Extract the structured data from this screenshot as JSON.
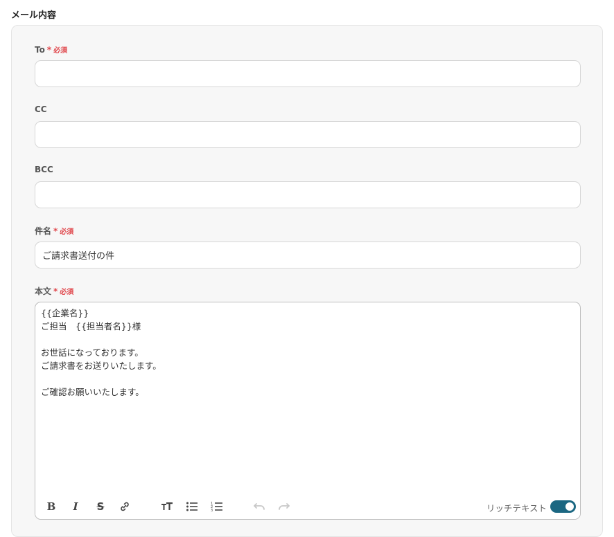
{
  "section": {
    "title": "メール内容"
  },
  "required_text": "必須",
  "required_star": "*",
  "fields": {
    "to": {
      "label": "To",
      "value": ""
    },
    "cc": {
      "label": "CC",
      "value": ""
    },
    "bcc": {
      "label": "BCC",
      "value": ""
    },
    "subject": {
      "label": "件名",
      "value": "ご請求書送付の件"
    },
    "body": {
      "label": "本文",
      "value": "{{企業名}}\nご担当　{{担当者名}}様\n\nお世話になっております。\nご請求書をお送りいたします。\n\nご確認お願いいたします。"
    }
  },
  "toolbar": {
    "buttons": [
      "bold-icon",
      "italic-icon",
      "strikethrough-icon",
      "link-icon",
      "text-size-icon",
      "bulleted-list-icon",
      "numbered-list-icon",
      "undo-icon",
      "redo-icon"
    ],
    "rich_text_label": "リッチテキスト",
    "rich_text_enabled": true
  },
  "colors": {
    "required": "#e0474c",
    "toggle": "#1b6782"
  }
}
